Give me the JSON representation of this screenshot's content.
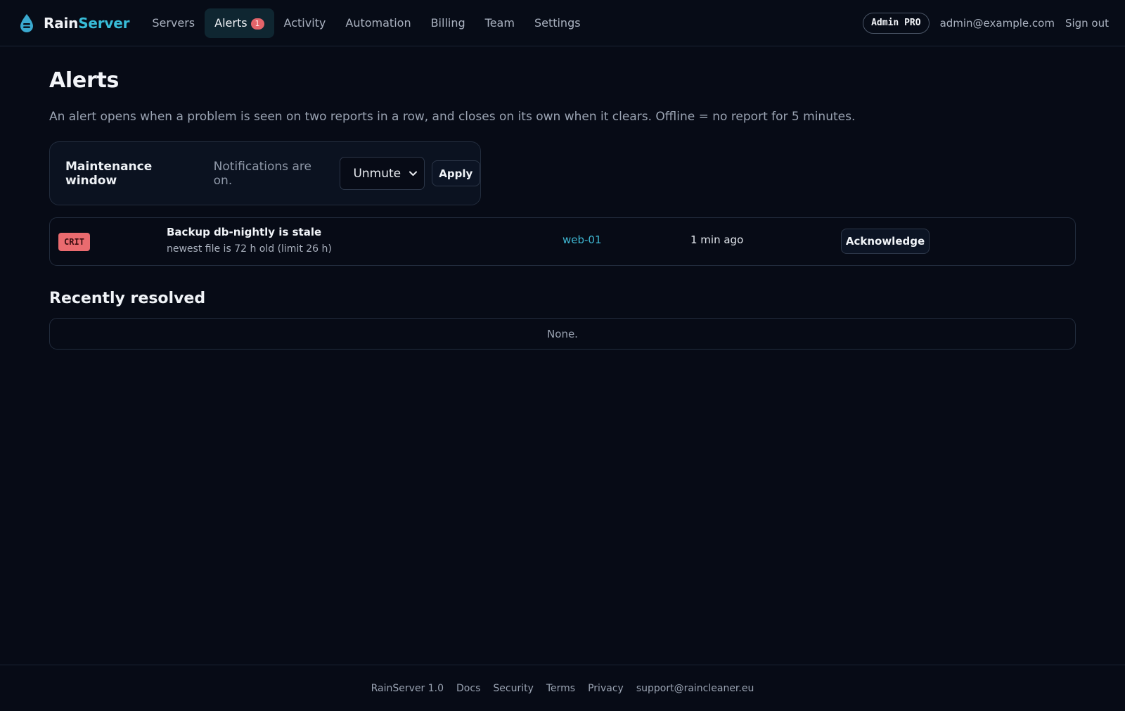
{
  "brand": {
    "name_part1": "Rain",
    "name_part2": "Server",
    "logo_icon": "droplet-icon"
  },
  "nav": {
    "items": [
      {
        "label": "Servers"
      },
      {
        "label": "Alerts",
        "count": "1",
        "active": true
      },
      {
        "label": "Activity"
      },
      {
        "label": "Automation"
      },
      {
        "label": "Billing"
      },
      {
        "label": "Team"
      },
      {
        "label": "Settings"
      }
    ]
  },
  "account": {
    "plan_badge": "Admin PRO",
    "email": "admin@example.com",
    "sign_out": "Sign out"
  },
  "page": {
    "title": "Alerts",
    "intro": "An alert opens when a problem is seen on two reports in a row, and closes on its own when it clears. Offline = no report for 5 minutes."
  },
  "maintenance": {
    "title": "Maintenance window",
    "status": "Notifications are on.",
    "select_value": "Unmute",
    "apply_label": "Apply"
  },
  "alerts": [
    {
      "severity": "CRIT",
      "title": "Backup db-nightly is stale",
      "detail": "newest file is 72 h old (limit 26 h)",
      "host": "web-01",
      "time": "1 min ago",
      "action": "Acknowledge"
    }
  ],
  "resolved": {
    "heading": "Recently resolved",
    "empty_text": "None."
  },
  "footer": {
    "version": "RainServer 1.0",
    "links": [
      "Docs",
      "Security",
      "Terms",
      "Privacy",
      "support@raincleaner.eu"
    ]
  },
  "colors": {
    "background": "#070b16",
    "accent": "#38bdd8",
    "critical": "#ea6b6f",
    "active_tab": "#0f2631"
  }
}
